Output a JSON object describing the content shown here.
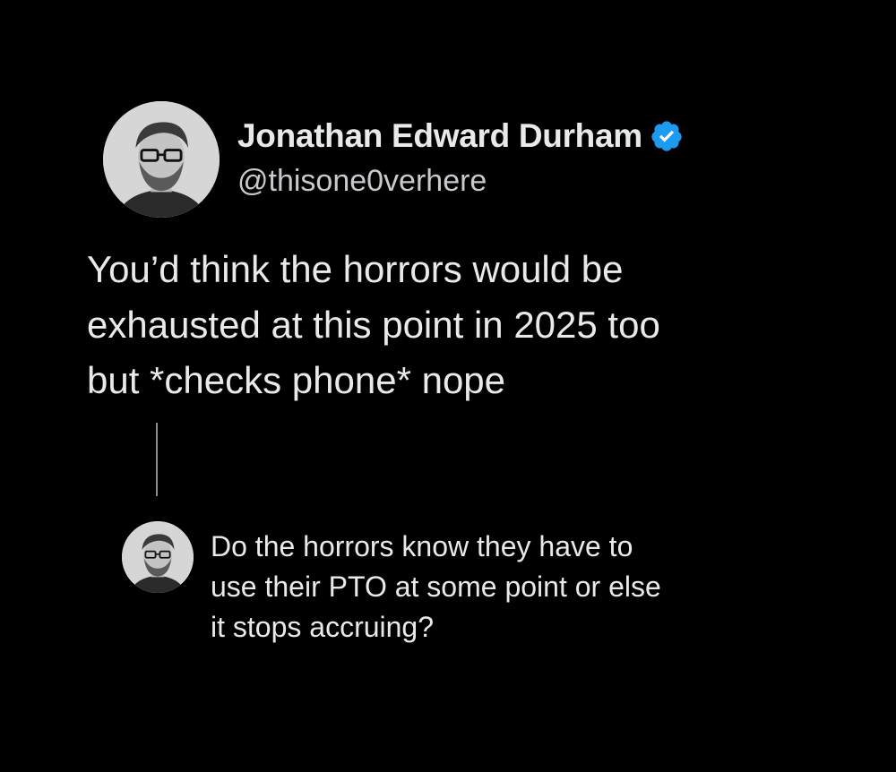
{
  "tweet": {
    "author_name": "Jonathan Edward Durham",
    "author_handle": "@thisone0verhere",
    "verified_icon": "verified-badge-icon",
    "avatar_icon": "profile-photo",
    "body_lines": [
      "You’d think the horrors would be",
      "exhausted at this point in 2025 too",
      "but *checks phone* nope"
    ]
  },
  "reply": {
    "avatar_icon": "profile-photo",
    "body_lines": [
      "Do the horrors know they have to",
      "use their PTO at some point or else",
      "it stops accruing?"
    ]
  },
  "colors": {
    "background": "#000000",
    "text": "#e7e9ea",
    "handle": "#c7c9cc",
    "verified": "#1d9bf0",
    "thread_line": "#8a8d91"
  }
}
